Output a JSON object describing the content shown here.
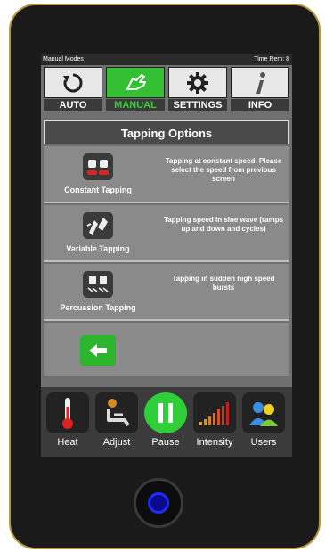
{
  "status_bar": {
    "left_text": "Manual Modes",
    "right_text": "Time Rem: 8"
  },
  "tabs": [
    {
      "label": "AUTO",
      "icon": "refresh-icon",
      "active": false
    },
    {
      "label": "MANUAL",
      "icon": "hand-icon",
      "active": true
    },
    {
      "label": "SETTINGS",
      "icon": "gear-icon",
      "active": false
    },
    {
      "label": "INFO",
      "icon": "info-icon",
      "active": false
    }
  ],
  "header": {
    "title": "Tapping Options"
  },
  "options": [
    {
      "name": "Constant Tapping",
      "description": "Tapping at constant speed. Please select the speed from previous screen",
      "icon": "constant-tapping-icon"
    },
    {
      "name": "Variable Tapping",
      "description": "Tapping speed in sine wave (ramps up and down and cycles)",
      "icon": "variable-tapping-icon"
    },
    {
      "name": "Percussion Tapping",
      "description": "Tapping in sudden high speed bursts",
      "icon": "percussion-tapping-icon"
    }
  ],
  "back_button": {
    "icon": "back-arrow-icon"
  },
  "bottom_bar": [
    {
      "label": "Heat",
      "icon": "thermometer-icon"
    },
    {
      "label": "Adjust",
      "icon": "chair-adjust-icon"
    },
    {
      "label": "Pause",
      "icon": "pause-icon"
    },
    {
      "label": "Intensity",
      "icon": "intensity-icon"
    },
    {
      "label": "Users",
      "icon": "users-icon"
    }
  ],
  "colors": {
    "accent_green": "#33c033",
    "tab_bar": "#3a3a3a",
    "panel_gray": "#8a8a8a",
    "home_blue": "#1f2ef0"
  }
}
